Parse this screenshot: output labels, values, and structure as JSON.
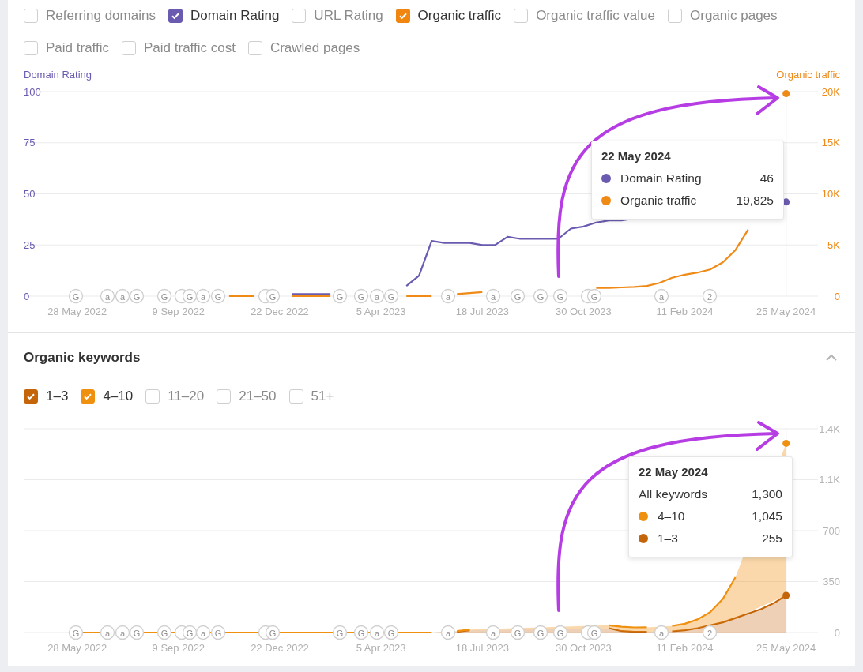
{
  "metric_toggles": [
    {
      "label": "Referring domains",
      "checked": false
    },
    {
      "label": "Domain Rating",
      "checked": true,
      "color": "#6b5bb0"
    },
    {
      "label": "URL Rating",
      "checked": false
    },
    {
      "label": "Organic traffic",
      "checked": true,
      "color": "#f0850f"
    },
    {
      "label": "Organic traffic value",
      "checked": false
    },
    {
      "label": "Organic pages",
      "checked": false
    },
    {
      "label": "Paid traffic",
      "checked": false
    },
    {
      "label": "Paid traffic cost",
      "checked": false
    },
    {
      "label": "Crawled pages",
      "checked": false
    }
  ],
  "traffic_chart": {
    "chart_data": {
      "type": "line",
      "categories": [
        null,
        "28 May 2022",
        null,
        null,
        null,
        null,
        null,
        null,
        null,
        "9 Sep 2022",
        null,
        null,
        null,
        null,
        null,
        null,
        null,
        "22 Dec 2022",
        null,
        null,
        null,
        null,
        null,
        null,
        null,
        "5 Apr 2023",
        null,
        null,
        null,
        null,
        null,
        null,
        null,
        "18 Jul 2023",
        null,
        null,
        null,
        null,
        null,
        null,
        null,
        "30 Oct 2023",
        null,
        null,
        null,
        null,
        null,
        null,
        null,
        "11 Feb 2024",
        null,
        null,
        null,
        null,
        null,
        null,
        null,
        "25 May 2024"
      ],
      "series": [
        {
          "name": "Domain Rating",
          "color": "#6b5bb0",
          "values": [
            null,
            null,
            null,
            null,
            null,
            null,
            null,
            null,
            null,
            null,
            null,
            null,
            null,
            null,
            null,
            null,
            null,
            null,
            1,
            1,
            1,
            1,
            null,
            null,
            null,
            null,
            null,
            5,
            10,
            27,
            26,
            26,
            26,
            25,
            25,
            29,
            28,
            28,
            28,
            28,
            33,
            34,
            36,
            37,
            37,
            38,
            null,
            null,
            null,
            null,
            null,
            null,
            null,
            null,
            null,
            null,
            null,
            46
          ]
        },
        {
          "name": "Organic traffic",
          "color": "#ef8a17",
          "axis": "y2",
          "values": [
            null,
            null,
            null,
            null,
            null,
            null,
            null,
            null,
            null,
            null,
            null,
            null,
            null,
            0,
            0,
            0,
            null,
            null,
            0,
            0,
            0,
            0,
            null,
            null,
            null,
            null,
            null,
            0,
            0,
            0,
            null,
            200,
            300,
            400,
            null,
            null,
            null,
            null,
            null,
            null,
            null,
            null,
            800,
            800,
            850,
            900,
            1000,
            1300,
            1800,
            2100,
            2300,
            2600,
            3300,
            4500,
            6500,
            null,
            null,
            19800
          ]
        }
      ],
      "grid": true,
      "ylim": [
        0,
        100
      ],
      "y2lim": [
        0,
        20000
      ],
      "yticks": [
        {
          "value": 0,
          "label": "0"
        },
        {
          "value": 25,
          "label": "25"
        },
        {
          "value": 50,
          "label": "50"
        },
        {
          "value": 75,
          "label": "75"
        },
        {
          "value": 100,
          "label": "100"
        }
      ],
      "y2ticks": [
        {
          "value": 0,
          "label": "0"
        },
        {
          "value": 5000,
          "label": "5K"
        },
        {
          "value": 10000,
          "label": "10K"
        },
        {
          "value": 15000,
          "label": "15K"
        },
        {
          "value": 20000,
          "label": "20K"
        }
      ]
    },
    "events": [
      {
        "kind": "letter",
        "text": "G"
      },
      {
        "kind": "letter",
        "text": "a"
      },
      {
        "kind": "letter",
        "text": "a"
      },
      {
        "kind": "letter",
        "text": "G"
      },
      {
        "kind": "letter",
        "text": "G"
      },
      {
        "kind": "blank"
      },
      {
        "kind": "letter",
        "text": "G"
      },
      {
        "kind": "letter",
        "text": "a"
      },
      {
        "kind": "letter",
        "text": "G"
      },
      {
        "kind": "blank"
      },
      {
        "kind": "letter",
        "text": "G"
      },
      {
        "kind": "letter",
        "text": "G"
      },
      {
        "kind": "letter",
        "text": "G"
      },
      {
        "kind": "letter",
        "text": "a"
      },
      {
        "kind": "letter",
        "text": "G"
      },
      {
        "kind": "letter",
        "text": "a"
      },
      {
        "kind": "letter",
        "text": "a"
      },
      {
        "kind": "letter",
        "text": "G"
      },
      {
        "kind": "letter",
        "text": "G"
      },
      {
        "kind": "letter",
        "text": "G"
      },
      {
        "kind": "blank"
      },
      {
        "kind": "letter",
        "text": "G"
      },
      {
        "kind": "letter",
        "text": "a"
      },
      {
        "kind": "letter",
        "text": "2"
      }
    ],
    "tooltip": {
      "date": "22 May 2024",
      "rows": [
        {
          "kind": "series",
          "value": "46"
        },
        {
          "kind": "series",
          "value": "19,825"
        }
      ]
    }
  },
  "keywords_section": {
    "title": "Organic keywords",
    "expanded": true,
    "position_toggles": [
      {
        "label": "1–3",
        "checked": true,
        "color": "#c4650a"
      },
      {
        "label": "4–10",
        "checked": true,
        "color": "#f0900f"
      },
      {
        "label": "11–20",
        "checked": false
      },
      {
        "label": "21–50",
        "checked": false
      },
      {
        "label": "51+",
        "checked": false
      }
    ],
    "chart": {
      "chart_data": {
        "type": "area",
        "stacked": true,
        "categories": [
          null,
          "28 May 2022",
          null,
          null,
          null,
          null,
          null,
          null,
          null,
          "9 Sep 2022",
          null,
          null,
          null,
          null,
          null,
          null,
          null,
          "22 Dec 2022",
          null,
          null,
          null,
          null,
          null,
          null,
          null,
          "5 Apr 2023",
          null,
          null,
          null,
          null,
          null,
          null,
          null,
          "18 Jul 2023",
          null,
          null,
          null,
          null,
          null,
          null,
          null,
          "30 Oct 2023",
          null,
          null,
          null,
          null,
          null,
          null,
          null,
          "11 Feb 2024",
          null,
          null,
          null,
          null,
          null,
          null,
          null,
          "25 May 2024"
        ],
        "series": [
          {
            "name": "1–3",
            "color": "#c4650a",
            "values": [
              null,
              0,
              0,
              0,
              0,
              0,
              0,
              0,
              0,
              0,
              0,
              0,
              0,
              0,
              0,
              0,
              0,
              0,
              0,
              0,
              0,
              0,
              0,
              0,
              0,
              0,
              0,
              0,
              0,
              0,
              null,
              5,
              15,
              null,
              null,
              null,
              null,
              null,
              null,
              null,
              null,
              null,
              null,
              30,
              10,
              5,
              5,
              null,
              8,
              15,
              30,
              50,
              70,
              100,
              130,
              160,
              200,
              255
            ]
          },
          {
            "name": "4–10",
            "color": "#f0900f",
            "values": [
              null,
              0,
              0,
              0,
              0,
              0,
              0,
              0,
              0,
              0,
              0,
              0,
              0,
              0,
              0,
              0,
              0,
              0,
              0,
              0,
              0,
              0,
              0,
              0,
              0,
              0,
              0,
              0,
              0,
              0,
              null,
              5,
              5,
              null,
              null,
              null,
              null,
              null,
              null,
              null,
              null,
              null,
              null,
              20,
              30,
              30,
              31,
              null,
              37,
              45,
              60,
              90,
              160,
              280,
              null,
              null,
              null,
              1045
            ]
          }
        ],
        "grid": true,
        "ylim": [
          0,
          1400
        ],
        "yticks": [
          {
            "value": 0,
            "label": "0"
          },
          {
            "value": 350,
            "label": "350"
          },
          {
            "value": 700,
            "label": "700"
          },
          {
            "value": 1050,
            "label": "1.1K"
          },
          {
            "value": 1400,
            "label": "1.4K"
          }
        ]
      },
      "events": [
        {
          "kind": "letter",
          "text": "G"
        },
        {
          "kind": "letter",
          "text": "a"
        },
        {
          "kind": "letter",
          "text": "a"
        },
        {
          "kind": "letter",
          "text": "G"
        },
        {
          "kind": "letter",
          "text": "G"
        },
        {
          "kind": "blank"
        },
        {
          "kind": "letter",
          "text": "G"
        },
        {
          "kind": "letter",
          "text": "a"
        },
        {
          "kind": "letter",
          "text": "G"
        },
        {
          "kind": "blank"
        },
        {
          "kind": "letter",
          "text": "G"
        },
        {
          "kind": "letter",
          "text": "G"
        },
        {
          "kind": "letter",
          "text": "G"
        },
        {
          "kind": "letter",
          "text": "a"
        },
        {
          "kind": "letter",
          "text": "G"
        },
        {
          "kind": "letter",
          "text": "a"
        },
        {
          "kind": "letter",
          "text": "a"
        },
        {
          "kind": "letter",
          "text": "G"
        },
        {
          "kind": "letter",
          "text": "G"
        },
        {
          "kind": "letter",
          "text": "G"
        },
        {
          "kind": "blank"
        },
        {
          "kind": "letter",
          "text": "G"
        },
        {
          "kind": "letter",
          "text": "a"
        },
        {
          "kind": "letter",
          "text": "2"
        }
      ],
      "tooltip": {
        "date": "22 May 2024",
        "rows": [
          {
            "kind": "total",
            "label": "All keywords",
            "value": "1,300"
          },
          {
            "kind": "series",
            "value": "1,045"
          },
          {
            "kind": "series",
            "value": "255"
          }
        ]
      }
    }
  }
}
